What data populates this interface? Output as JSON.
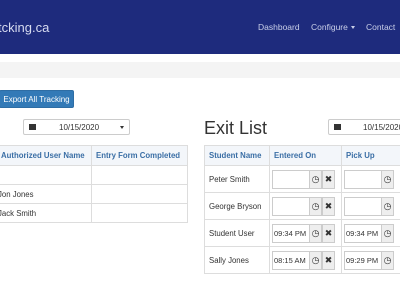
{
  "navbar": {
    "brand": "tcking.ca",
    "links": [
      "Dashboard",
      "Configure",
      "Contact"
    ]
  },
  "toolbar": {
    "export_label": "Export All Tracking"
  },
  "auth_list": {
    "date": "10/15/2020",
    "columns": [
      "Authorized User Name",
      "Entry Form Completed"
    ],
    "rows": [
      [
        "",
        ""
      ],
      [
        "Jon Jones",
        ""
      ],
      [
        "Jack Smith",
        ""
      ]
    ]
  },
  "exit_list": {
    "title": "Exit List",
    "date": "10/15/2020",
    "columns": [
      "Student Name",
      "Entered On",
      "Pick Up"
    ],
    "rows": [
      {
        "name": "Peter Smith",
        "entered": "",
        "pickup": ""
      },
      {
        "name": "George Bryson",
        "entered": "",
        "pickup": ""
      },
      {
        "name": "Student User",
        "entered": "09:34 PM",
        "pickup": "09:34 PM"
      },
      {
        "name": "Sally Jones",
        "entered": "08:15 AM",
        "pickup": "09:29 PM"
      }
    ]
  },
  "icons": {
    "clock": "clock-icon",
    "clear": "clear-icon",
    "calendar": "calendar-icon"
  },
  "colors": {
    "navbar": "#1e2b7d",
    "primary": "#337ab7",
    "header_text": "#3a6ea5"
  }
}
